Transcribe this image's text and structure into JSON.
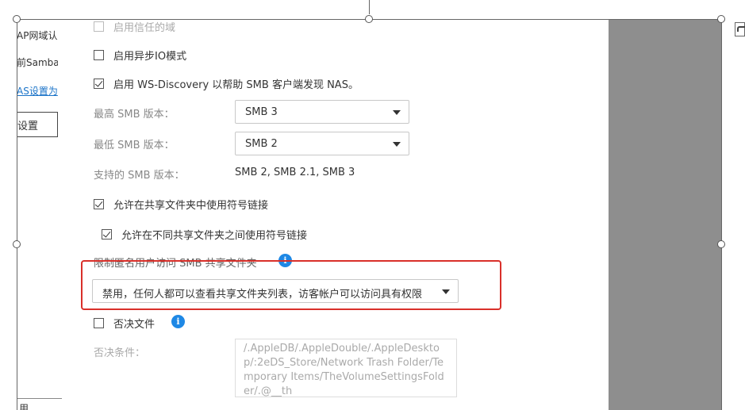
{
  "background": {
    "lines": [
      "AP网域认",
      "前Samba",
      "AS设置为"
    ],
    "button_label": "设置",
    "bottom_text": "用"
  },
  "dialog": {
    "trusted_domains_label": "启用信任的域",
    "async_io_label": "启用异步IO模式",
    "ws_discovery_label": "启用 WS-Discovery 以帮助 SMB 客户端发现 NAS。",
    "max_smb_label": "最高 SMB 版本：",
    "max_smb_value": "SMB 3",
    "min_smb_label": "最低 SMB 版本：",
    "min_smb_value": "SMB 2",
    "supported_smb_label": "支持的 SMB 版本：",
    "supported_smb_value": "SMB 2, SMB 2.1, SMB 3",
    "symlink_in_share_label": "允许在共享文件夹中使用符号链接",
    "symlink_across_share_label": "允许在不同共享文件夹之间使用符号链接",
    "anon_restrict_label": "限制匿名用户访问 SMB 共享文件夹",
    "anon_restrict_value": "禁用，任何人都可以查看共享文件夹列表，访客帐户可以访问具有权限",
    "veto_files_label": "否决文件",
    "veto_condition_label": "否决条件：",
    "veto_condition_value": "/.AppleDB/.AppleDouble/.AppleDesktop/:2eDS_Store/Network Trash Folder/Temporary Items/TheVolumeSettingsFolder/.@__th",
    "info_glyph": "i"
  },
  "states": {
    "trusted_domains": false,
    "async_io": false,
    "ws_discovery": true,
    "symlink_in_share": true,
    "symlink_across_share": true,
    "veto_files": false
  },
  "colors": {
    "highlight_box": "#d9302a",
    "info_icon": "#1e88e5",
    "backdrop": "#8e8e8e"
  }
}
